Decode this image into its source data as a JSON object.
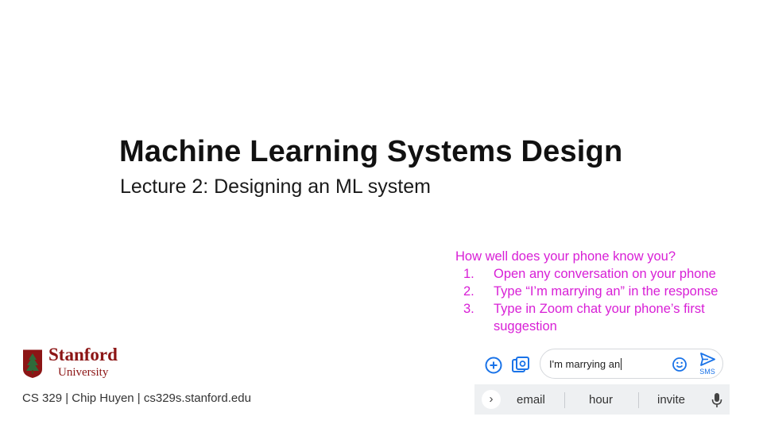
{
  "slide": {
    "title": "Machine Learning Systems Design",
    "subtitle": "Lecture 2: Designing an ML system"
  },
  "prompt": {
    "heading": "How well does your phone know you?",
    "color": "#d81fd6",
    "items": [
      {
        "num": "1.",
        "text": "Open any conversation on your phone"
      },
      {
        "num": "2.",
        "text": "Type “I’m marrying an” in the response"
      },
      {
        "num": "3.",
        "text": "Type in Zoom chat your phone’s first suggestion"
      }
    ]
  },
  "logo": {
    "line1": "Stanford",
    "line2": "University",
    "color": "#8c1515"
  },
  "footer": {
    "text": "CS 329 | Chip Huyen | cs329s.stanford.edu"
  },
  "phone": {
    "compose_value": "I'm marrying an",
    "send_label": "SMS",
    "accent": "#1a73e8",
    "icons": [
      "add-icon",
      "gallery-icon",
      "emoji-icon",
      "send-icon",
      "chevron-right-icon",
      "mic-icon"
    ],
    "suggestions": [
      "email",
      "hour",
      "invite"
    ]
  }
}
